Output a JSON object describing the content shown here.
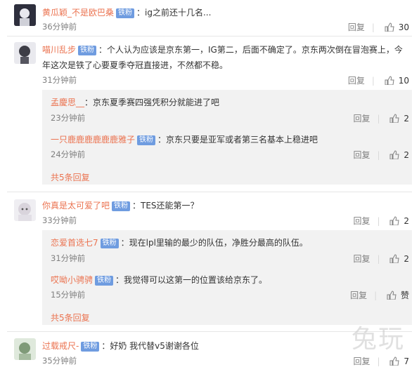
{
  "comments": [
    {
      "name": "黄瓜颖_不是欧巴桑",
      "badge": "铁粉",
      "text": "：ig之前还十几名...",
      "time": "36分钟前",
      "reply": "回复",
      "likes": "30"
    },
    {
      "name": "喵川乱步",
      "badge": "铁粉",
      "text": "：个人认为应该是京东第一，IG第二，后面不确定了。京东两次倒在冒泡赛上，今",
      "text2": "年这次是铁了心要夏季夺冠直接进，不然都不稳。",
      "time": "31分钟前",
      "reply": "回复",
      "likes": "10",
      "replies": [
        {
          "name": "孟慶思__",
          "text": "：京东夏季赛四强凭积分就能进了吧",
          "time": "23分钟前",
          "reply": "回复",
          "likes": "2"
        },
        {
          "name": "一只鹿鹿鹿鹿鹿鹿雅子",
          "badge": "铁粉",
          "text": "：京东只要是亚军或者第三名基本上稳进吧",
          "time": "24分钟前",
          "reply": "回复",
          "likes": "2"
        }
      ],
      "more": "共5条回复"
    },
    {
      "name": "你真是太可爱了吧",
      "badge": "铁粉",
      "text": "：TES还能第一？",
      "time": "33分钟前",
      "reply": "回复",
      "likes": "2",
      "replies": [
        {
          "name": "恋爱首选七7",
          "badge": "铁粉",
          "text": "：现在lpl里输的最少的队伍，净胜分最高的队伍。",
          "time": "31分钟前",
          "reply": "回复",
          "likes": "2"
        },
        {
          "name": "哎呦小骋骋",
          "badge": "铁粉",
          "text": "：我觉得可以这第一的位置该给京东了。",
          "time": "15分钟前",
          "reply": "回复",
          "likes": "赞"
        }
      ],
      "more": "共5条回复"
    },
    {
      "name": "过载戒尺-",
      "badge": "铁粉",
      "text": "：好奶 我代替v5谢谢各位",
      "time": "35分钟前",
      "reply": "回复",
      "likes": "7"
    }
  ],
  "watermark": "兔玩",
  "colors": {
    "name": "#eb7350",
    "badge": "#6f9ce0",
    "subbox": "#f2f2f2"
  }
}
